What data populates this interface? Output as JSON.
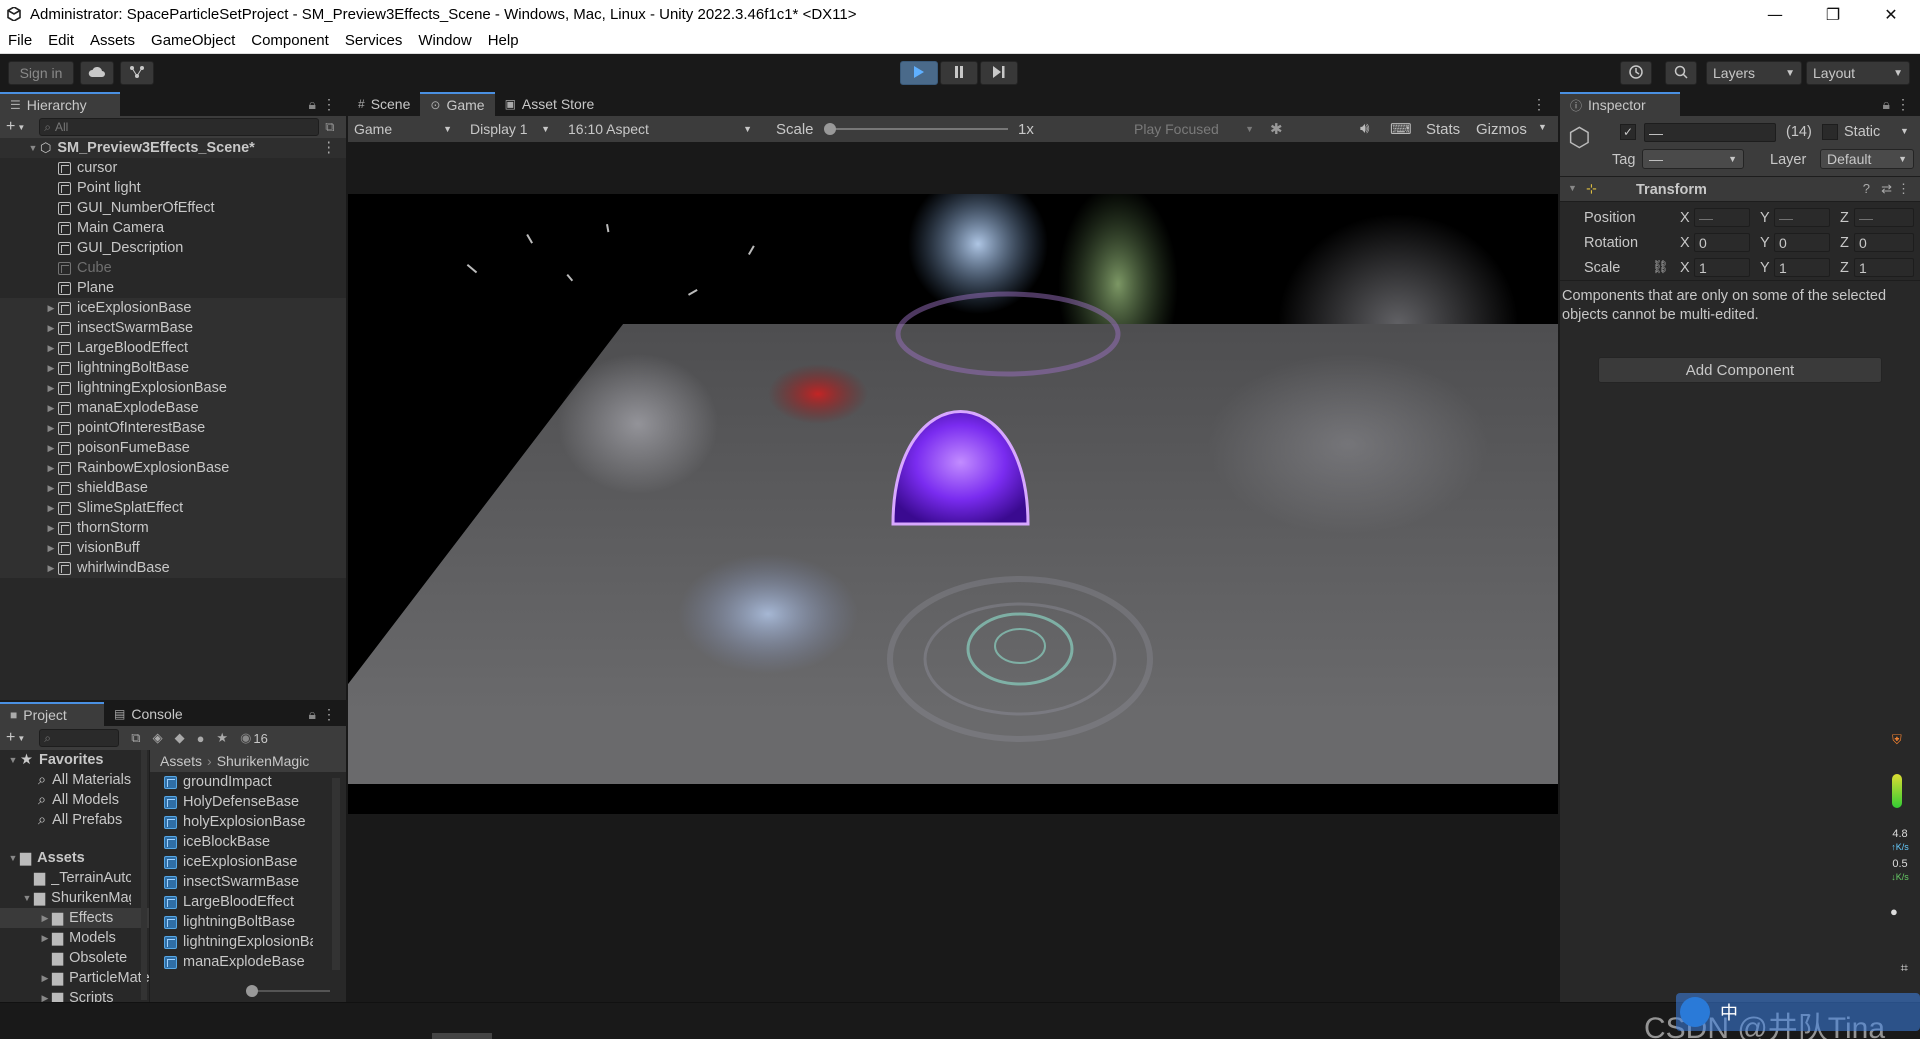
{
  "window": {
    "title": "Administrator: SpaceParticleSetProject - SM_Preview3Effects_Scene - Windows, Mac, Linux - Unity 2022.3.46f1c1* <DX11>",
    "minimize": "—",
    "maximize": "❐",
    "close": "✕"
  },
  "menu": [
    "File",
    "Edit",
    "Assets",
    "GameObject",
    "Component",
    "Services",
    "Window",
    "Help"
  ],
  "toolbar": {
    "sign_in": "Sign in",
    "layers": "Layers",
    "layout": "Layout"
  },
  "hierarchy": {
    "tab": "Hierarchy",
    "search_placeholder": "All",
    "scene_name": "SM_Preview3Effects_Scene*",
    "items": [
      {
        "name": "cursor",
        "expand": false,
        "disabled": false
      },
      {
        "name": "Point light",
        "expand": false,
        "disabled": false
      },
      {
        "name": "GUI_NumberOfEffect",
        "expand": false,
        "disabled": false
      },
      {
        "name": "Main Camera",
        "expand": false,
        "disabled": false
      },
      {
        "name": "GUI_Description",
        "expand": false,
        "disabled": false
      },
      {
        "name": "Cube",
        "expand": false,
        "disabled": true
      },
      {
        "name": "Plane",
        "expand": false,
        "disabled": false
      },
      {
        "name": "iceExplosionBase",
        "expand": true,
        "disabled": false
      },
      {
        "name": "insectSwarmBase",
        "expand": true,
        "disabled": false
      },
      {
        "name": "LargeBloodEffect",
        "expand": true,
        "disabled": false
      },
      {
        "name": "lightningBoltBase",
        "expand": true,
        "disabled": false
      },
      {
        "name": "lightningExplosionBase",
        "expand": true,
        "disabled": false
      },
      {
        "name": "manaExplodeBase",
        "expand": true,
        "disabled": false
      },
      {
        "name": "pointOfInterestBase",
        "expand": true,
        "disabled": false
      },
      {
        "name": "poisonFumeBase",
        "expand": true,
        "disabled": false
      },
      {
        "name": "RainbowExplosionBase",
        "expand": true,
        "disabled": false
      },
      {
        "name": "shieldBase",
        "expand": true,
        "disabled": false
      },
      {
        "name": "SlimeSplatEffect",
        "expand": true,
        "disabled": false
      },
      {
        "name": "thornStorm",
        "expand": true,
        "disabled": false
      },
      {
        "name": "visionBuff",
        "expand": true,
        "disabled": false
      },
      {
        "name": "whirlwindBase",
        "expand": true,
        "disabled": false
      }
    ]
  },
  "game": {
    "tabs": [
      "Scene",
      "Game",
      "Asset Store"
    ],
    "active_tab": "Game",
    "view_mode": "Game",
    "display": "Display 1",
    "aspect": "16:10 Aspect",
    "scale_label": "Scale",
    "scale_value": "1x",
    "play_mode": "Play Focused",
    "stats": "Stats",
    "gizmos": "Gizmos"
  },
  "project": {
    "tabs": [
      "Project",
      "Console"
    ],
    "count": "16",
    "favorites_label": "Favorites",
    "favorites": [
      "All Materials",
      "All Models",
      "All Prefabs"
    ],
    "assets_label": "Assets",
    "asset_tree": [
      {
        "name": "_TerrainAutoUpgrade",
        "level": 1,
        "expand": false
      },
      {
        "name": "ShurikenMagic",
        "level": 1,
        "expand": true
      },
      {
        "name": "Effects",
        "level": 2,
        "expand": true,
        "selected": true
      },
      {
        "name": "Models",
        "level": 2,
        "expand": true
      },
      {
        "name": "Obsolete",
        "level": 2,
        "expand": false
      },
      {
        "name": "ParticleMaterials",
        "level": 2,
        "expand": true
      },
      {
        "name": "Scripts",
        "level": 2,
        "expand": true
      }
    ],
    "breadcrumb": [
      "Assets",
      "ShurikenMagic"
    ],
    "files": [
      "groundImpact",
      "HolyDefenseBase",
      "holyExplosionBase",
      "iceBlockBase",
      "iceExplosionBase",
      "insectSwarmBase",
      "LargeBloodEffect",
      "lightningBoltBase",
      "lightningExplosionBase",
      "manaExplodeBase"
    ]
  },
  "inspector": {
    "tab": "Inspector",
    "name_value": "—",
    "count": "(14)",
    "static_label": "Static",
    "tag_label": "Tag",
    "tag_value": "—",
    "layer_label": "Layer",
    "layer_value": "Default",
    "transform_label": "Transform",
    "position_label": "Position",
    "rotation_label": "Rotation",
    "scale_label": "Scale",
    "position": {
      "x": "—",
      "y": "—",
      "z": "—"
    },
    "rotation": {
      "x": "0",
      "y": "0",
      "z": "0"
    },
    "scale": {
      "x": "1",
      "y": "1",
      "z": "1"
    },
    "axis": {
      "x": "X",
      "y": "Y",
      "z": "Z"
    },
    "note": "Components that are only on some of the selected objects cannot be multi-edited.",
    "add_component": "Add Component"
  },
  "side_widget": {
    "up_rate": "4.8",
    "up_unit": "K/s",
    "down_rate": "0.5",
    "down_unit": "K/s"
  },
  "taskbar": {
    "watermark": "CSDN @井队Tina",
    "ime": "中"
  },
  "colors": {
    "accent": "#4a90e2",
    "panel": "#282828",
    "header": "#191919",
    "shield": "#8a3cff"
  }
}
